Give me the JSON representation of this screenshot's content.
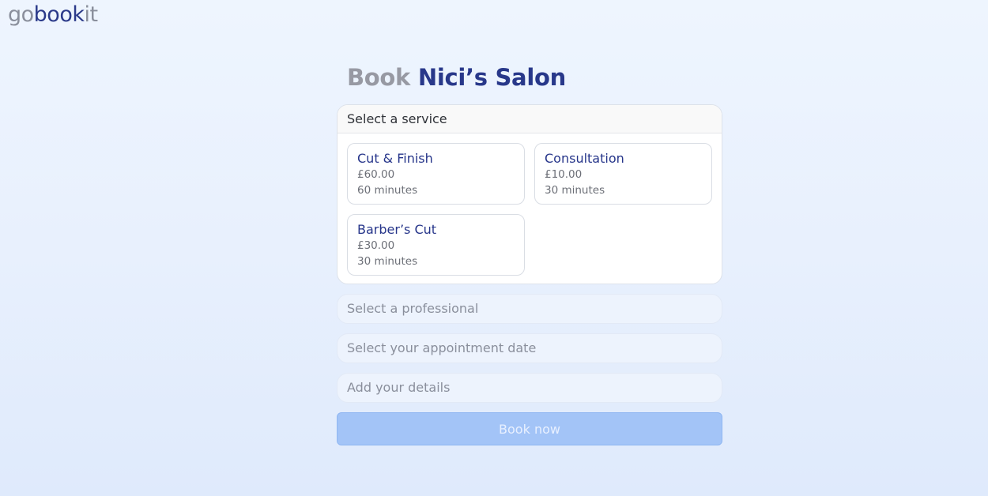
{
  "brand": {
    "logo_part1": "go",
    "logo_part2": "book",
    "logo_part3": "it"
  },
  "header": {
    "title_prefix": "Book",
    "salon_name": "Nici’s Salon"
  },
  "service_section": {
    "header": "Select a service",
    "services": [
      {
        "name": "Cut & Finish",
        "price": "£60.00",
        "duration": "60 minutes"
      },
      {
        "name": "Consultation",
        "price": "£10.00",
        "duration": "30 minutes"
      },
      {
        "name": "Barber’s Cut",
        "price": "£30.00",
        "duration": "30 minutes"
      }
    ]
  },
  "steps": {
    "professional": "Select a professional",
    "date": "Select your appointment date",
    "details": "Add your details"
  },
  "actions": {
    "book_now": "Book now"
  },
  "colors": {
    "brand_dark_blue": "#28388a",
    "brand_grey": "#8a8f9c",
    "button_disabled": "#a3c4f7"
  }
}
